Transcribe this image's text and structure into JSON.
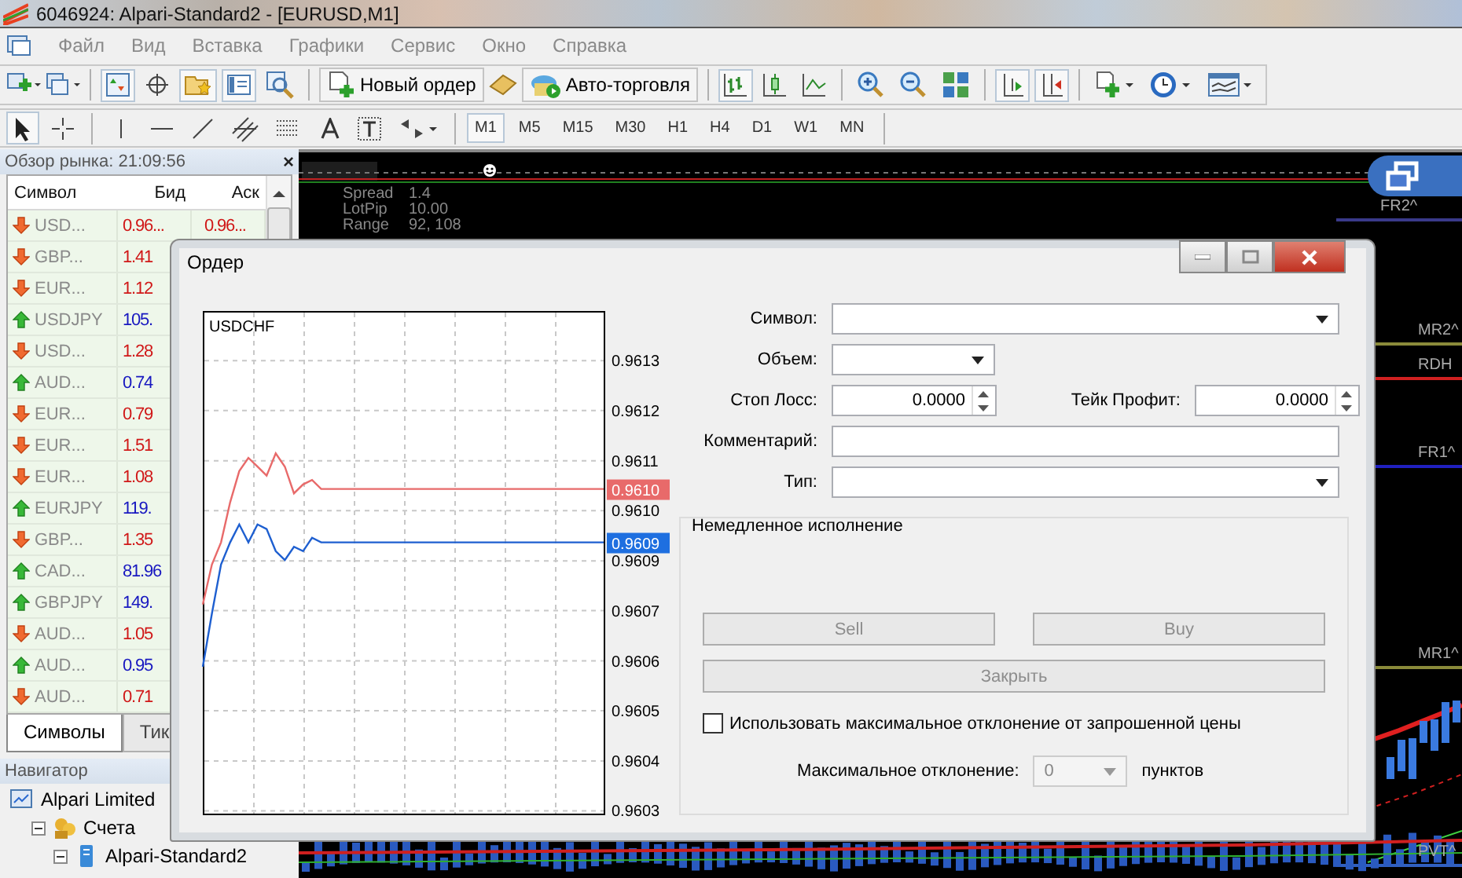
{
  "window": {
    "title": "6046924: Alpari-Standard2 - [EURUSD,M1]"
  },
  "menu": [
    "Файл",
    "Вид",
    "Вставка",
    "Графики",
    "Сервис",
    "Окно",
    "Справка"
  ],
  "toolbar": {
    "view_buttons": [
      {
        "on": true
      },
      {
        "on": false
      },
      {
        "on": true
      },
      {
        "on": true
      },
      {
        "on": false
      }
    ],
    "new_order": "Новый ордер",
    "auto_trading": "Авто-торговля",
    "chart_types": [
      {
        "selected": true
      },
      {
        "selected": false
      },
      {
        "selected": false
      }
    ],
    "autoscroll": {
      "on": true
    },
    "chart_shift": {
      "on": true
    }
  },
  "timeframes": [
    {
      "label": "M1",
      "selected": true
    },
    {
      "label": "M5",
      "selected": false
    },
    {
      "label": "M15",
      "selected": false
    },
    {
      "label": "M30",
      "selected": false
    },
    {
      "label": "H1",
      "selected": false
    },
    {
      "label": "H4",
      "selected": false
    },
    {
      "label": "D1",
      "selected": false
    },
    {
      "label": "W1",
      "selected": false
    },
    {
      "label": "MN",
      "selected": false
    }
  ],
  "market_watch": {
    "title": "Обзор рынка: 21:09:56",
    "close": "×",
    "columns": [
      "Символ",
      "Бид",
      "Аск"
    ],
    "rows": [
      {
        "symbol": "USD...",
        "bid": "0.96...",
        "ask": "0.96...",
        "kind": "down"
      },
      {
        "symbol": "GBP...",
        "bid": "1.41",
        "kind": "down"
      },
      {
        "symbol": "EUR...",
        "bid": "1.12",
        "kind": "down"
      },
      {
        "symbol": "USDJPY",
        "bid": "105.",
        "kind": "up"
      },
      {
        "symbol": "USD...",
        "bid": "1.28",
        "kind": "down"
      },
      {
        "symbol": "AUD...",
        "bid": "0.74",
        "kind": "up"
      },
      {
        "symbol": "EUR...",
        "bid": "0.79",
        "kind": "down"
      },
      {
        "symbol": "EUR...",
        "bid": "1.51",
        "kind": "down"
      },
      {
        "symbol": "EUR...",
        "bid": "1.08",
        "kind": "down"
      },
      {
        "symbol": "EURJPY",
        "bid": "119.",
        "kind": "up"
      },
      {
        "symbol": "GBP...",
        "bid": "1.35",
        "kind": "down"
      },
      {
        "symbol": "CAD...",
        "bid": "81.96",
        "kind": "up"
      },
      {
        "symbol": "GBPJPY",
        "bid": "149.",
        "kind": "up"
      },
      {
        "symbol": "AUD...",
        "bid": "1.05",
        "kind": "down"
      },
      {
        "symbol": "AUD...",
        "bid": "0.95",
        "kind": "up"
      },
      {
        "symbol": "AUD...",
        "bid": "0.71",
        "kind": "down"
      }
    ],
    "tabs": [
      {
        "label": "Символы",
        "selected": true
      },
      {
        "label": "Тик",
        "selected": false
      }
    ]
  },
  "navigator": {
    "title": "Навигатор",
    "tree": [
      {
        "label": "Alpari Limited",
        "children": [
          {
            "label": "Счета",
            "expanded": true,
            "children": [
              {
                "label": "Alpari-Standard2",
                "expanded": true
              }
            ]
          }
        ]
      }
    ]
  },
  "chart": {
    "info": [
      {
        "label": "Spread",
        "value": "1.4"
      },
      {
        "label": "LotPip",
        "value": "10.00"
      },
      {
        "label": "Range",
        "value": "92, 108"
      }
    ],
    "levels": [
      {
        "label": "FR2^",
        "color": "#3a3a8a"
      },
      {
        "label": "MR2^",
        "color": "#8a8a3a"
      },
      {
        "label": "RDH",
        "color": "#d02020"
      },
      {
        "label": "FR1^",
        "color": "#2020c0"
      },
      {
        "label": "MR1^",
        "color": "#8a8a3a"
      },
      {
        "label": "PVT^",
        "color": "#3060c0"
      }
    ]
  },
  "order_dialog": {
    "title": "Ордер",
    "chart": {
      "symbol": "USDCHF",
      "chart_data": {
        "type": "line",
        "grid": true,
        "categories": [
          null,
          null,
          null,
          null,
          null,
          null,
          null,
          null,
          null,
          null,
          null,
          null,
          null,
          null,
          null,
          null,
          null,
          null,
          null,
          null,
          null,
          null,
          null,
          null,
          null,
          null,
          null,
          null,
          null,
          null,
          null,
          null,
          null,
          null,
          null,
          null,
          null,
          null,
          null,
          null,
          null,
          null,
          null,
          null,
          null
        ],
        "ylim": [
          0.96028,
          0.96141
        ],
        "yticks": [
          {
            "value": 0.9613,
            "label": "0.9613"
          },
          {
            "value": 0.961188,
            "label": "0.9612"
          },
          {
            "value": 0.961075,
            "label": "0.9611"
          },
          {
            "value": 0.960963,
            "label": "0.9610"
          },
          {
            "value": 0.96085,
            "label": "0.9609"
          },
          {
            "value": 0.960738,
            "label": "0.9607"
          },
          {
            "value": 0.960625,
            "label": "0.9606"
          },
          {
            "value": 0.960513,
            "label": "0.9605"
          },
          {
            "value": 0.9604,
            "label": "0.9604"
          },
          {
            "value": 0.960288,
            "label": "0.9603"
          }
        ],
        "series": [
          {
            "color": "#e86a6a",
            "values": [
              0.96075,
              0.96084,
              0.96089,
              0.96098,
              0.96105,
              0.96108,
              0.96106,
              0.96104,
              0.96109,
              0.96106,
              0.961,
              0.96102,
              0.96103,
              0.96101,
              0.96101,
              0.96101,
              0.96101,
              0.96101,
              0.96101,
              0.96101,
              0.96101,
              0.96101,
              0.96101,
              0.96101,
              0.96101,
              0.96101,
              0.96101,
              0.96101,
              0.96101,
              0.96101,
              0.96101,
              0.96101,
              0.96101,
              0.96101,
              0.96101,
              0.96101,
              0.96101,
              0.96101,
              0.96101,
              0.96101,
              0.96101,
              0.96101,
              0.96101,
              0.96101,
              0.96101
            ]
          },
          {
            "color": "#1e5fd0",
            "values": [
              0.96061,
              0.96073,
              0.96084,
              0.96089,
              0.96093,
              0.96089,
              0.96093,
              0.96092,
              0.96087,
              0.96085,
              0.96088,
              0.96087,
              0.9609,
              0.96089,
              0.96089,
              0.96089,
              0.96089,
              0.96089,
              0.96089,
              0.96089,
              0.96089,
              0.96089,
              0.96089,
              0.96089,
              0.96089,
              0.96089,
              0.96089,
              0.96089,
              0.96089,
              0.96089,
              0.96089,
              0.96089,
              0.96089,
              0.96089,
              0.96089,
              0.96089,
              0.96089,
              0.96089,
              0.96089,
              0.96089,
              0.96089,
              0.96089,
              0.96089,
              0.96089,
              0.96089
            ]
          }
        ]
      },
      "price_tags": [
        {
          "text": "0.9610",
          "color": "#e86a6a"
        },
        {
          "text": "0.9609",
          "color": "#1e6fe0"
        }
      ]
    },
    "form": {
      "symbol_label": "Символ:",
      "volume_label": "Объем:",
      "stop_loss_label": "Стоп Лосс:",
      "stop_loss": "0.0000",
      "take_profit_label": "Тейк Профит:",
      "take_profit": "0.0000",
      "comment_label": "Комментарий:",
      "type_label": "Тип:"
    },
    "execution": {
      "title": "Немедленное исполнение",
      "trade_buttons": [
        {
          "label": "Sell",
          "disabled": true
        },
        {
          "label": "Buy",
          "disabled": true
        }
      ],
      "close_button": {
        "label": "Закрыть",
        "disabled": true
      },
      "deviation_checkbox": {
        "label": "Использовать максимальное отклонение от запрошенной цены",
        "checked": false
      },
      "deviation_label": "Максимальное отклонение:",
      "deviation": "0",
      "deviation_disabled": true,
      "unit": "пунктов"
    }
  }
}
